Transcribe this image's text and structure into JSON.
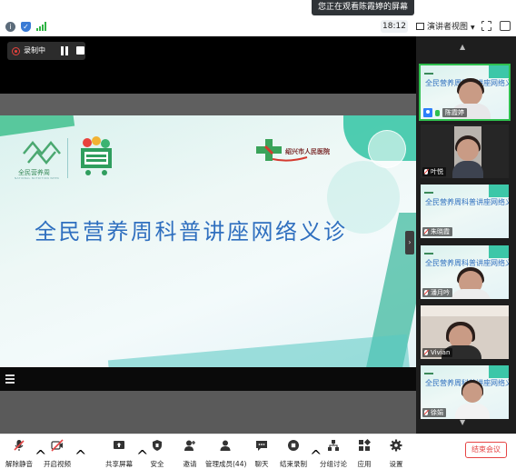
{
  "topbar": {
    "toast": "您正在观看陈霞婷的屏幕",
    "clock": "18:12",
    "view_label": "演讲者视图"
  },
  "recording": {
    "label": "录制中"
  },
  "slide": {
    "title": "全民营养周科普讲座网络义诊",
    "logo_left_text": "全民营养周",
    "logo_left_sub": "NATIONAL NUTRITION WEEK",
    "logo_right_text": "绍兴市人民医院"
  },
  "gallery": {
    "tiles": [
      {
        "name": "陈霞婷",
        "mini_title": "全民营养周科普讲座网络义诊"
      },
      {
        "name": "叶悦"
      },
      {
        "name": "朱晓霞",
        "mini_title": "全民营养周科普讲座网络义诊"
      },
      {
        "name": "潘月吟",
        "mini_title": "全民营养周科普讲座网络义诊"
      },
      {
        "name": "Vivian"
      },
      {
        "name": "徐娟",
        "mini_title": "全民营养周科普讲座网络义诊"
      }
    ]
  },
  "toolbar": {
    "mute": "解除静音",
    "video": "开启视频",
    "share": "共享屏幕",
    "security": "安全",
    "invite": "邀请",
    "participants": "管理成员(44)",
    "chat": "聊天",
    "record": "结束录制",
    "breakout": "分组讨论",
    "apps": "应用",
    "settings": "设置",
    "end": "结束会议"
  },
  "colors": {
    "accent_green": "#2fbf4e",
    "end_red": "#e64545",
    "slide_title": "#2f6fbf"
  }
}
